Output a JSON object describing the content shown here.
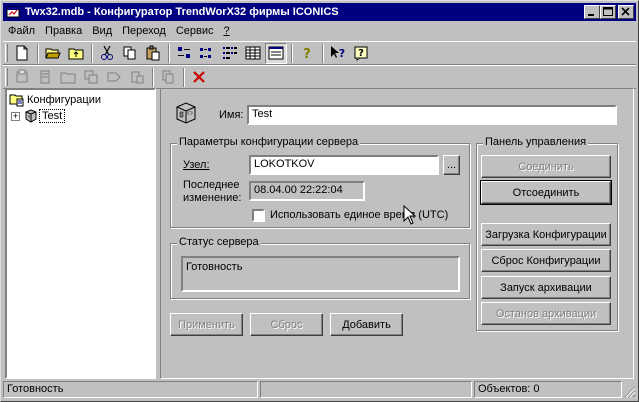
{
  "window": {
    "title": "Twx32.mdb - Конфигуратор TrendWorX32 фирмы ICONICS"
  },
  "menu": [
    {
      "label": "Файл",
      "hotkey": "Ф"
    },
    {
      "label": "Правка",
      "hotkey": "П"
    },
    {
      "label": "Вид",
      "hotkey": "В"
    },
    {
      "label": "Переход",
      "hotkey": "х"
    },
    {
      "label": "Сервис",
      "hotkey": "С"
    },
    {
      "label": "?",
      "hotkey": "?"
    }
  ],
  "tree": {
    "root": "Конфигурации",
    "child": "Test",
    "child_expander": "+"
  },
  "form": {
    "name_label": "Имя:",
    "name_value": "Test",
    "server_group_title": "Параметры конфигурации сервера",
    "node_label": "Узел:",
    "node_value": "LOKOTKOV",
    "browse_label": "...",
    "last_change_label_1": "Последнее",
    "last_change_label_2": "изменение:",
    "last_change_value": "08.04.00 22:22:04",
    "utc_label": "Использовать единое время (UTC)",
    "status_group_title": "Статус сервера",
    "status_value": "Готовность",
    "apply_label": "Применить",
    "reset_label": "Сброс",
    "add_label": "Добавить"
  },
  "control_panel": {
    "title": "Панель управления",
    "connect_label": "Соединить",
    "disconnect_label": "Отсоединить",
    "load_config_label": "Загрузка Конфигурации",
    "reset_config_label": "Сброс Конфигурации",
    "start_archive_label": "Запуск архивации",
    "stop_archive_label": "Останов архивации"
  },
  "statusbar": {
    "status": "Готовность",
    "middle": "",
    "objects": "Объектов: 0"
  },
  "colors": {
    "titlebar": "#000080",
    "face": "#c0c0c0",
    "delete_icon": "#cc0000"
  }
}
